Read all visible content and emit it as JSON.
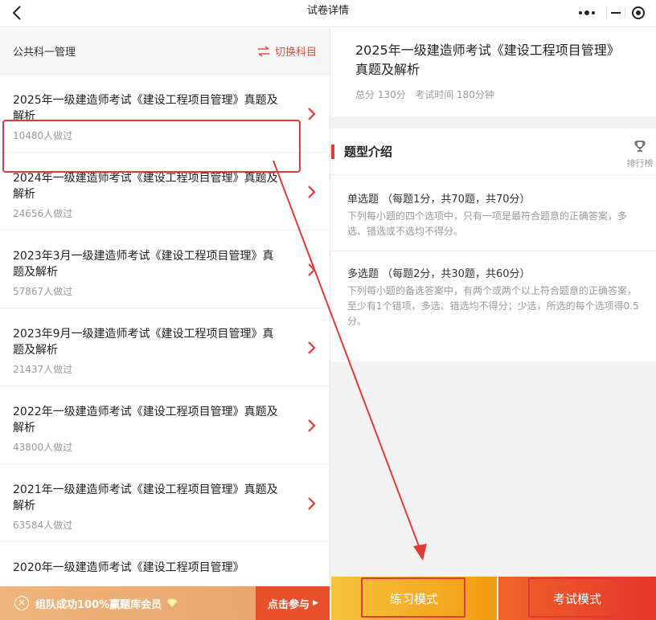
{
  "nav": {
    "title": "试卷详情"
  },
  "left": {
    "subject": "公共科一管理",
    "switch_label": "切换科目",
    "items": [
      {
        "title": "2025年一级建造师考试《建设工程项目管理》真题及解析",
        "count": "10480人做过"
      },
      {
        "title": "2024年一级建造师考试《建设工程项目管理》真题及解析",
        "count": "24656人做过"
      },
      {
        "title": "2023年3月一级建造师考试《建设工程项目管理》真题及解析",
        "count": "57867人做过"
      },
      {
        "title": "2023年9月一级建造师考试《建设工程项目管理》真题及解析",
        "count": "21437人做过"
      },
      {
        "title": "2022年一级建造师考试《建设工程项目管理》真题及解析",
        "count": "43800人做过"
      },
      {
        "title": "2021年一级建造师考试《建设工程项目管理》真题及解析",
        "count": "63584人做过"
      },
      {
        "title": "2020年一级建造师考试《建设工程项目管理》",
        "count": ""
      }
    ],
    "promo": {
      "text": "组队成功100%赢题库会员",
      "button": "点击参与"
    }
  },
  "right": {
    "exam_title": "2025年一级建造师考试《建设工程项目管理》真题及解析",
    "total": "总分 130分",
    "time": "考试时间 180分钟",
    "intro_title": "题型介绍",
    "rank_label": "排行榜",
    "qtypes": [
      {
        "name": "单选题 （每题1分，共70题，共70分）",
        "desc": "下列每小题的四个选项中，只有一项是最符合题意的正确答案，多选、错选或不选均不得分。"
      },
      {
        "name": "多选题 （每题2分，共30题，共60分）",
        "desc": "下列每小题的备选答案中，有两个或两个以上符合题意的正确答案，至少有1个错项，多选、错选均不得分；少选，所选的每个选项得0.5分。"
      }
    ],
    "practice_label": "练习模式",
    "exam_label": "考试模式"
  },
  "colors": {
    "accent": "#e53935",
    "practice": "#f39c12",
    "exam": "#e5352b",
    "promo": "#e6a46b"
  }
}
